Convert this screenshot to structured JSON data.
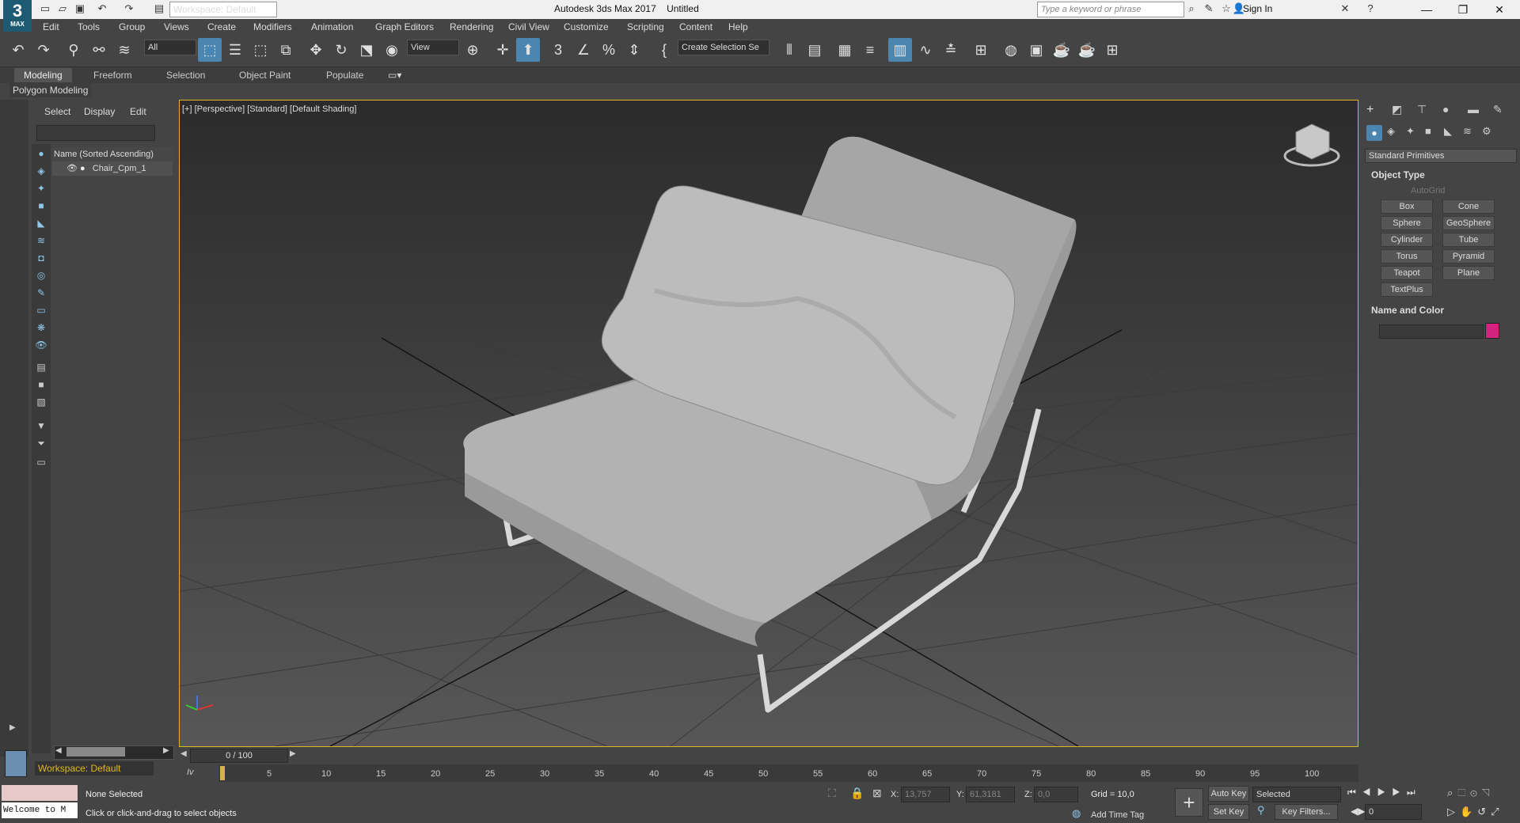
{
  "app": {
    "logo_text": "3",
    "logo_sub": "MAX",
    "title": "Autodesk 3ds Max 2017",
    "document": "Untitled",
    "workspace": "Workspace: Default",
    "search_placeholder": "Type a keyword or phrase",
    "sign_in": "Sign In"
  },
  "menu": [
    "Edit",
    "Tools",
    "Group",
    "Views",
    "Create",
    "Modifiers",
    "Animation",
    "Graph Editors",
    "Rendering",
    "Civil View",
    "Customize",
    "Scripting",
    "Content",
    "Help"
  ],
  "toolbar": {
    "selection_filter": "All",
    "ref_coord": "View",
    "named_selection": "Create Selection Se"
  },
  "ribbon": {
    "tabs": [
      "Modeling",
      "Freeform",
      "Selection",
      "Object Paint",
      "Populate"
    ],
    "active_tab": "Modeling",
    "sub": "Polygon Modeling"
  },
  "scene_explorer": {
    "tabs": [
      "Select",
      "Display",
      "Edit"
    ],
    "column_header": "Name (Sorted Ascending)",
    "objects": [
      "Chair_Cpm_1"
    ]
  },
  "viewport": {
    "label": "[+] [Perspective] [Standard] [Default Shading]"
  },
  "command_panel": {
    "category": "Standard Primitives",
    "object_type_title": "Object Type",
    "autogrid": "AutoGrid",
    "primitives": [
      "Box",
      "Cone",
      "Sphere",
      "GeoSphere",
      "Cylinder",
      "Tube",
      "Torus",
      "Pyramid",
      "Teapot",
      "Plane",
      "TextPlus"
    ],
    "name_color_title": "Name and Color",
    "object_color": "#d3237f"
  },
  "timeline": {
    "frame_display": "0 / 100",
    "ticks": [
      "5",
      "10",
      "15",
      "20",
      "25",
      "30",
      "35",
      "40",
      "45",
      "50",
      "55",
      "60",
      "65",
      "70",
      "75",
      "80",
      "85",
      "90",
      "95",
      "100"
    ]
  },
  "status": {
    "maxscript_output": "Welcome to M",
    "selection": "None Selected",
    "prompt": "Click or click-and-drag to select objects",
    "x_label": "X:",
    "x_value": "13,757",
    "y_label": "Y:",
    "y_value": "61,3181",
    "z_label": "Z:",
    "z_value": "0,0",
    "grid": "Grid = 10,0",
    "add_time_tag": "Add Time Tag",
    "auto_key": "Auto Key",
    "set_key": "Set Key",
    "key_mode": "Selected",
    "key_filters": "Key Filters...",
    "frame": "0",
    "workspace_status": "Workspace: Default"
  },
  "colors": {
    "viewport_border": "#e1b71d",
    "accent_blue": "#1e5b73"
  }
}
